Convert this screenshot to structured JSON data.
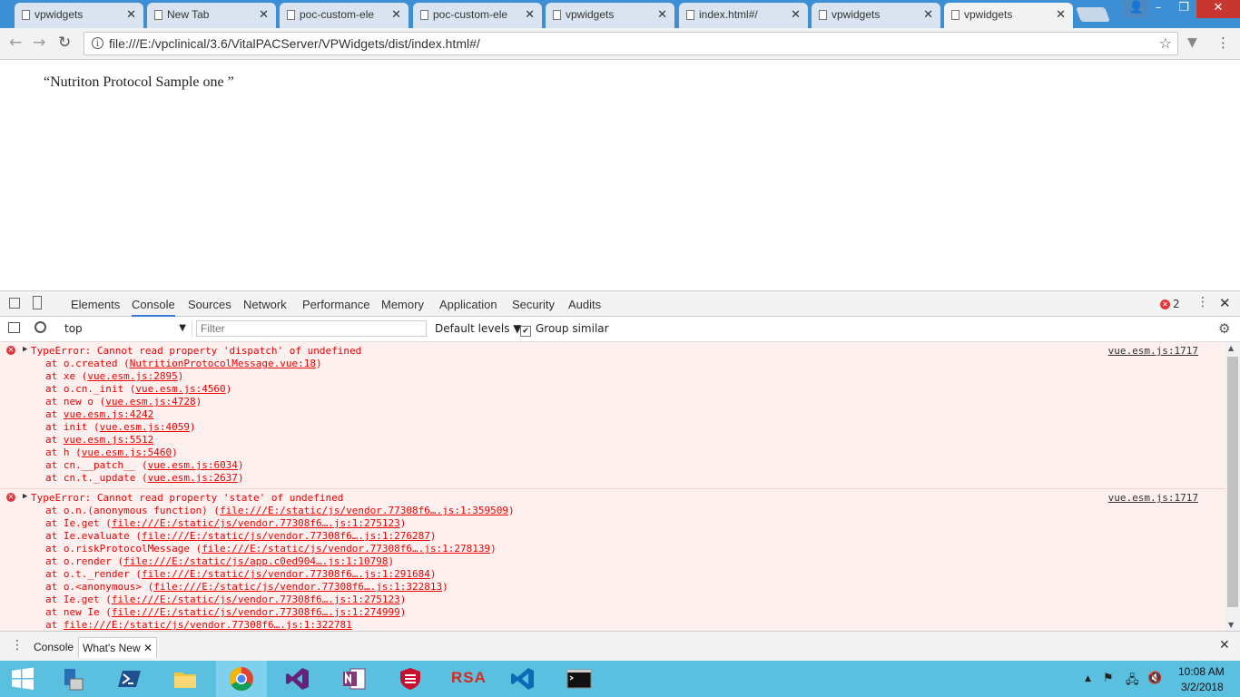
{
  "browser": {
    "tabs": [
      {
        "label": "vpwidgets",
        "close": "✕"
      },
      {
        "label": "New Tab",
        "close": "✕"
      },
      {
        "label": "poc-custom-ele",
        "close": "✕"
      },
      {
        "label": "poc-custom-ele",
        "close": "✕"
      },
      {
        "label": "vpwidgets",
        "close": "✕"
      },
      {
        "label": "index.html#/",
        "close": "✕"
      },
      {
        "label": "vpwidgets",
        "close": "✕"
      },
      {
        "label": "vpwidgets",
        "close": "✕"
      }
    ],
    "active_tab_index": 7,
    "url": "file:///E:/vpclinical/3.6/VitalPACServer/VPWidgets/dist/index.html#/",
    "info_glyph": "i"
  },
  "page": {
    "text": "“Nutriton Protocol Sample one ”"
  },
  "devtools": {
    "tabs": [
      "Elements",
      "Console",
      "Sources",
      "Network",
      "Performance",
      "Memory",
      "Application",
      "Security",
      "Audits"
    ],
    "active_tab": "Console",
    "error_count": "2",
    "context": "top",
    "filter_placeholder": "Filter",
    "levels_label": "Default levels",
    "group_similar_label": "Group similar",
    "group_similar_checked": true,
    "errors": [
      {
        "message": "TypeError: Cannot read property 'dispatch' of undefined",
        "source": "vue.esm.js:1717",
        "frames": [
          {
            "pre": "at o.created (",
            "link": "NutritionProtocolMessage.vue:18",
            "post": ")"
          },
          {
            "pre": "at xe (",
            "link": "vue.esm.js:2895",
            "post": ")"
          },
          {
            "pre": "at o.cn._init (",
            "link": "vue.esm.js:4560",
            "post": ")"
          },
          {
            "pre": "at new o (",
            "link": "vue.esm.js:4728",
            "post": ")"
          },
          {
            "pre": "at ",
            "link": "vue.esm.js:4242",
            "post": ""
          },
          {
            "pre": "at init (",
            "link": "vue.esm.js:4059",
            "post": ")"
          },
          {
            "pre": "at ",
            "link": "vue.esm.js:5512",
            "post": ""
          },
          {
            "pre": "at h (",
            "link": "vue.esm.js:5460",
            "post": ")"
          },
          {
            "pre": "at cn.__patch__ (",
            "link": "vue.esm.js:6034",
            "post": ")"
          },
          {
            "pre": "at cn.t._update (",
            "link": "vue.esm.js:2637",
            "post": ")"
          }
        ]
      },
      {
        "message": "TypeError: Cannot read property 'state' of undefined",
        "source": "vue.esm.js:1717",
        "frames": [
          {
            "pre": "at o.n.(anonymous function) (",
            "link": "file:///E:/static/js/vendor.77308f6….js:1:359509",
            "post": ")"
          },
          {
            "pre": "at Ie.get (",
            "link": "file:///E:/static/js/vendor.77308f6….js:1:275123",
            "post": ")"
          },
          {
            "pre": "at Ie.evaluate (",
            "link": "file:///E:/static/js/vendor.77308f6….js:1:276287",
            "post": ")"
          },
          {
            "pre": "at o.riskProtocolMessage (",
            "link": "file:///E:/static/js/vendor.77308f6….js:1:278139",
            "post": ")"
          },
          {
            "pre": "at o.render (",
            "link": "file:///E:/static/js/app.c0ed904….js:1:10798",
            "post": ")"
          },
          {
            "pre": "at o.t._render (",
            "link": "file:///E:/static/js/vendor.77308f6….js:1:291684",
            "post": ")"
          },
          {
            "pre": "at o.<anonymous> (",
            "link": "file:///E:/static/js/vendor.77308f6….js:1:322813",
            "post": ")"
          },
          {
            "pre": "at Ie.get (",
            "link": "file:///E:/static/js/vendor.77308f6….js:1:275123",
            "post": ")"
          },
          {
            "pre": "at new Ie (",
            "link": "file:///E:/static/js/vendor.77308f6….js:1:274999",
            "post": ")"
          },
          {
            "pre": "at ",
            "link": "file:///E:/static/js/vendor.77308f6….js:1:322781",
            "post": ""
          }
        ]
      }
    ],
    "drawer": {
      "tabs": [
        "Console",
        "What's New"
      ],
      "close": "✕"
    }
  },
  "taskbar": {
    "apps": [
      "start-icon",
      "server-manager-icon",
      "powershell-icon",
      "file-explorer-icon",
      "chrome-icon",
      "visual-studio-icon",
      "onenote-icon",
      "fortinet-icon",
      "rsa-icon",
      "vscode-icon",
      "command-prompt-icon"
    ],
    "rsa_label": "RSA",
    "time": "10:08 AM",
    "date": "3/2/2018"
  }
}
